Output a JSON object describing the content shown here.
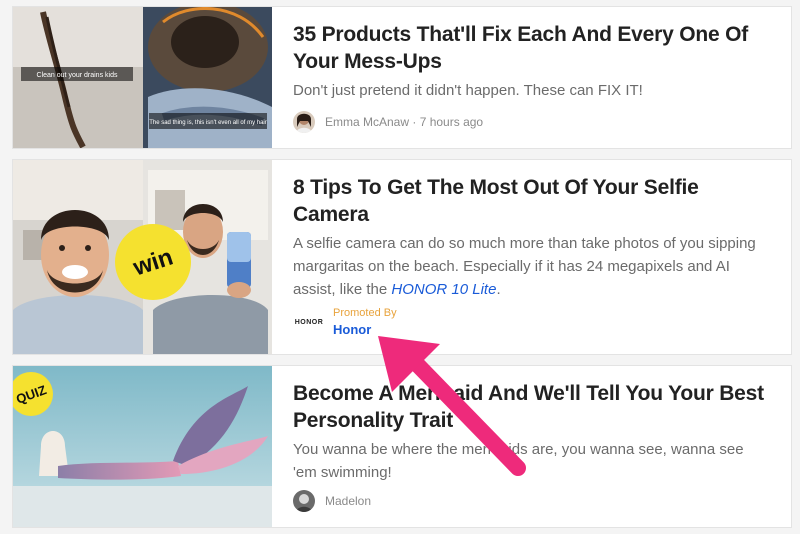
{
  "articles": [
    {
      "title": "35 Products That'll Fix Each And Every One Of Your Mess-Ups",
      "description": "Don't just pretend it didn't happen. These can FIX IT!",
      "thumb_caption_top": "Clean out your drains kids",
      "thumb_caption_bottom": "The sad thing is, this isn't even all of my hair",
      "author": "Emma McAnaw",
      "time": "7 hours ago"
    },
    {
      "title": "8 Tips To Get The Most Out Of Your Selfie Camera",
      "description": "A selfie camera can do so much more than take photos of you sipping margaritas on the beach. Especially if it has 24 megapixels and AI assist, like the",
      "description_link": "HONOR 10 Lite",
      "description_end": ".",
      "badge": "win",
      "promo_logo": "HONOR",
      "promoted_by": "Promoted By",
      "promoter": "Honor"
    },
    {
      "title": "Become A Mermaid And We'll Tell You Your Best Personality Trait",
      "description": "You wanna be where the mermaids are, you wanna see, wanna see 'em swimming!",
      "badge": "QUIZ",
      "author": "Madelon"
    }
  ],
  "colors": {
    "accent_pink": "#ee2a7b",
    "link_blue": "#1a5bd8",
    "promo_orange": "#e8a33c",
    "badge_yellow": "#f5e12f"
  }
}
